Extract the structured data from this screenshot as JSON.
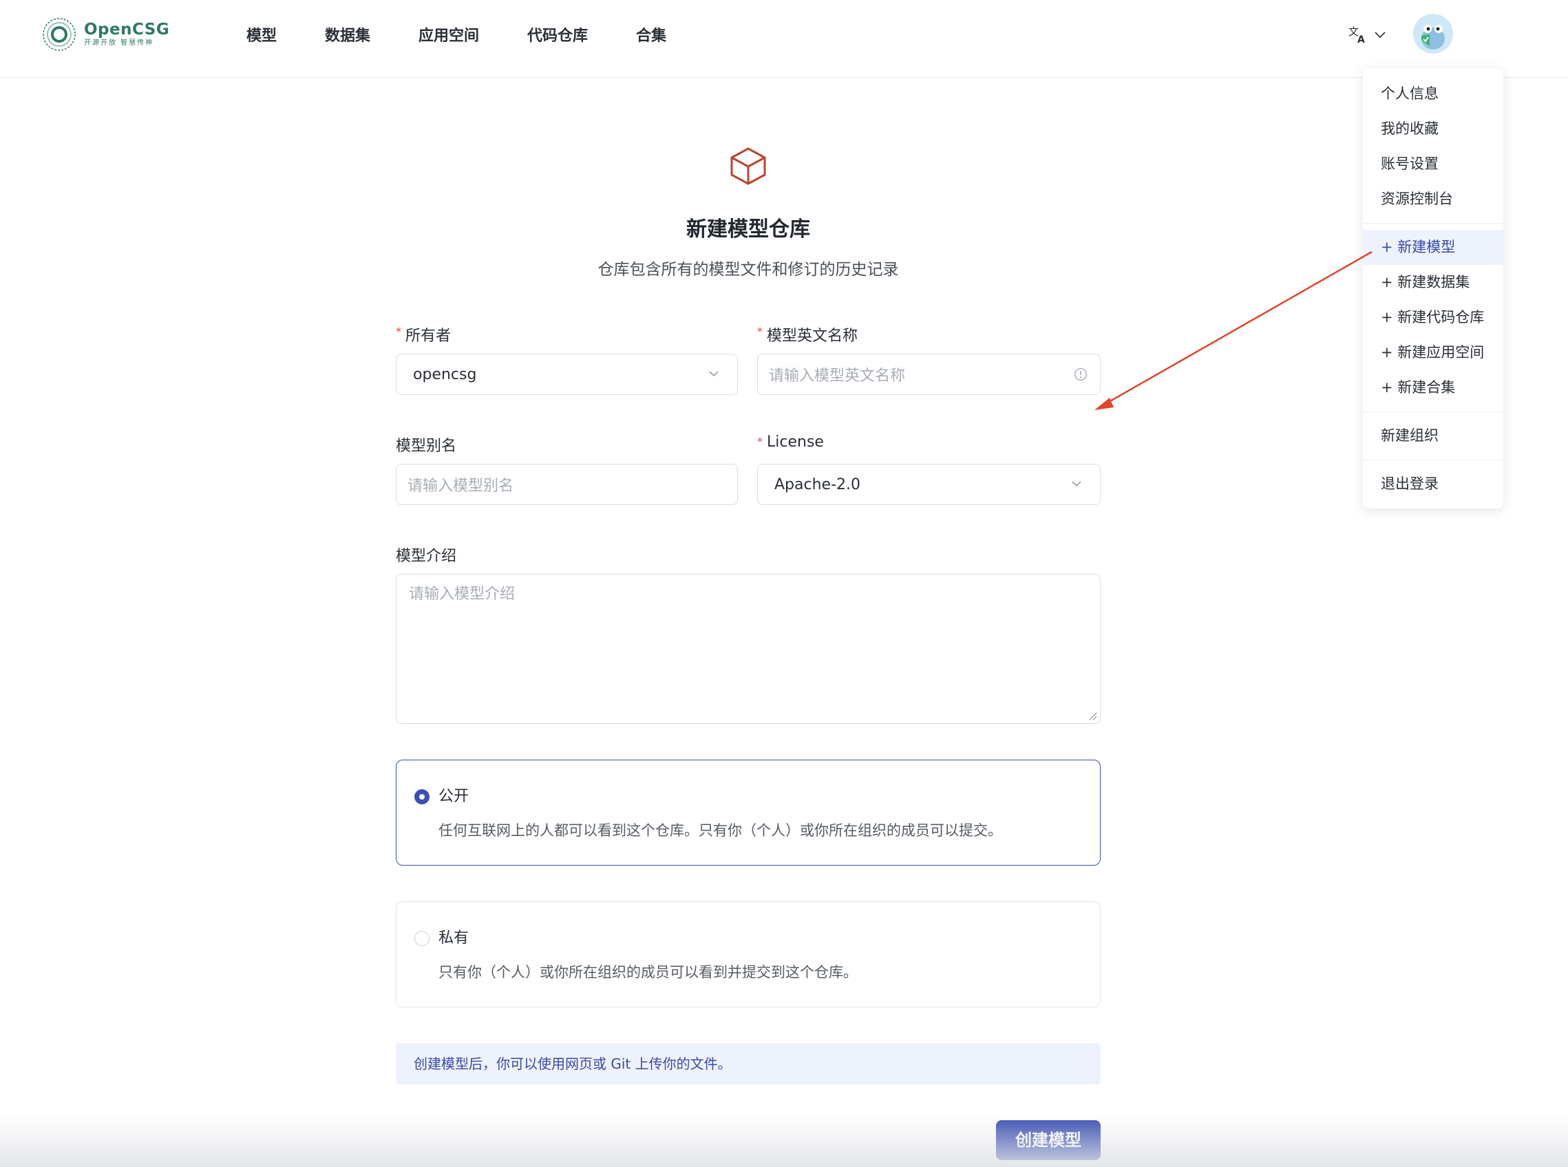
{
  "brand": {
    "name": "OpenCSG",
    "slogan": "开源开放 智慧传神",
    "color": "#2e7a66"
  },
  "nav": {
    "items": [
      "模型",
      "数据集",
      "应用空间",
      "代码仓库",
      "合集"
    ]
  },
  "header": {
    "language_icon": "translate-icon",
    "avatar_icon": "user-avatar"
  },
  "user_menu": {
    "group1": [
      "个人信息",
      "我的收藏",
      "账号设置",
      "资源控制台"
    ],
    "group2": [
      "+ 新建模型",
      "+ 新建数据集",
      "+ 新建代码仓库",
      "+ 新建应用空间",
      "+ 新建合集"
    ],
    "group3": [
      "新建组织"
    ],
    "group4": [
      "退出登录"
    ],
    "active_item": "+ 新建模型"
  },
  "annotation": {
    "arrow_color": "#e0442b"
  },
  "form": {
    "icon": "cube-icon",
    "title": "新建模型仓库",
    "subtitle": "仓库包含所有的模型文件和修订的历史记录",
    "owner": {
      "label": "所有者",
      "value": "opencsg"
    },
    "name_en": {
      "label": "模型英文名称",
      "placeholder": "请输入模型英文名称"
    },
    "alias": {
      "label": "模型别名",
      "placeholder": "请输入模型别名"
    },
    "license": {
      "label": "License",
      "value": "Apache-2.0"
    },
    "intro": {
      "label": "模型介绍",
      "placeholder": "请输入模型介绍"
    },
    "visibility": {
      "public": {
        "title": "公开",
        "desc": "任何互联网上的人都可以看到这个仓库。只有你（个人）或你所在组织的成员可以提交。",
        "selected": true
      },
      "private": {
        "title": "私有",
        "desc": "只有你（个人）或你所在组织的成员可以看到并提交到这个仓库。",
        "selected": false
      }
    },
    "info": "创建模型后，你可以使用网页或 Git 上传你的文件。",
    "submit_label": "创建模型"
  },
  "colors": {
    "primary": "#3b4fb5",
    "required": "#e5484d",
    "info_bg": "#eef2fd"
  }
}
